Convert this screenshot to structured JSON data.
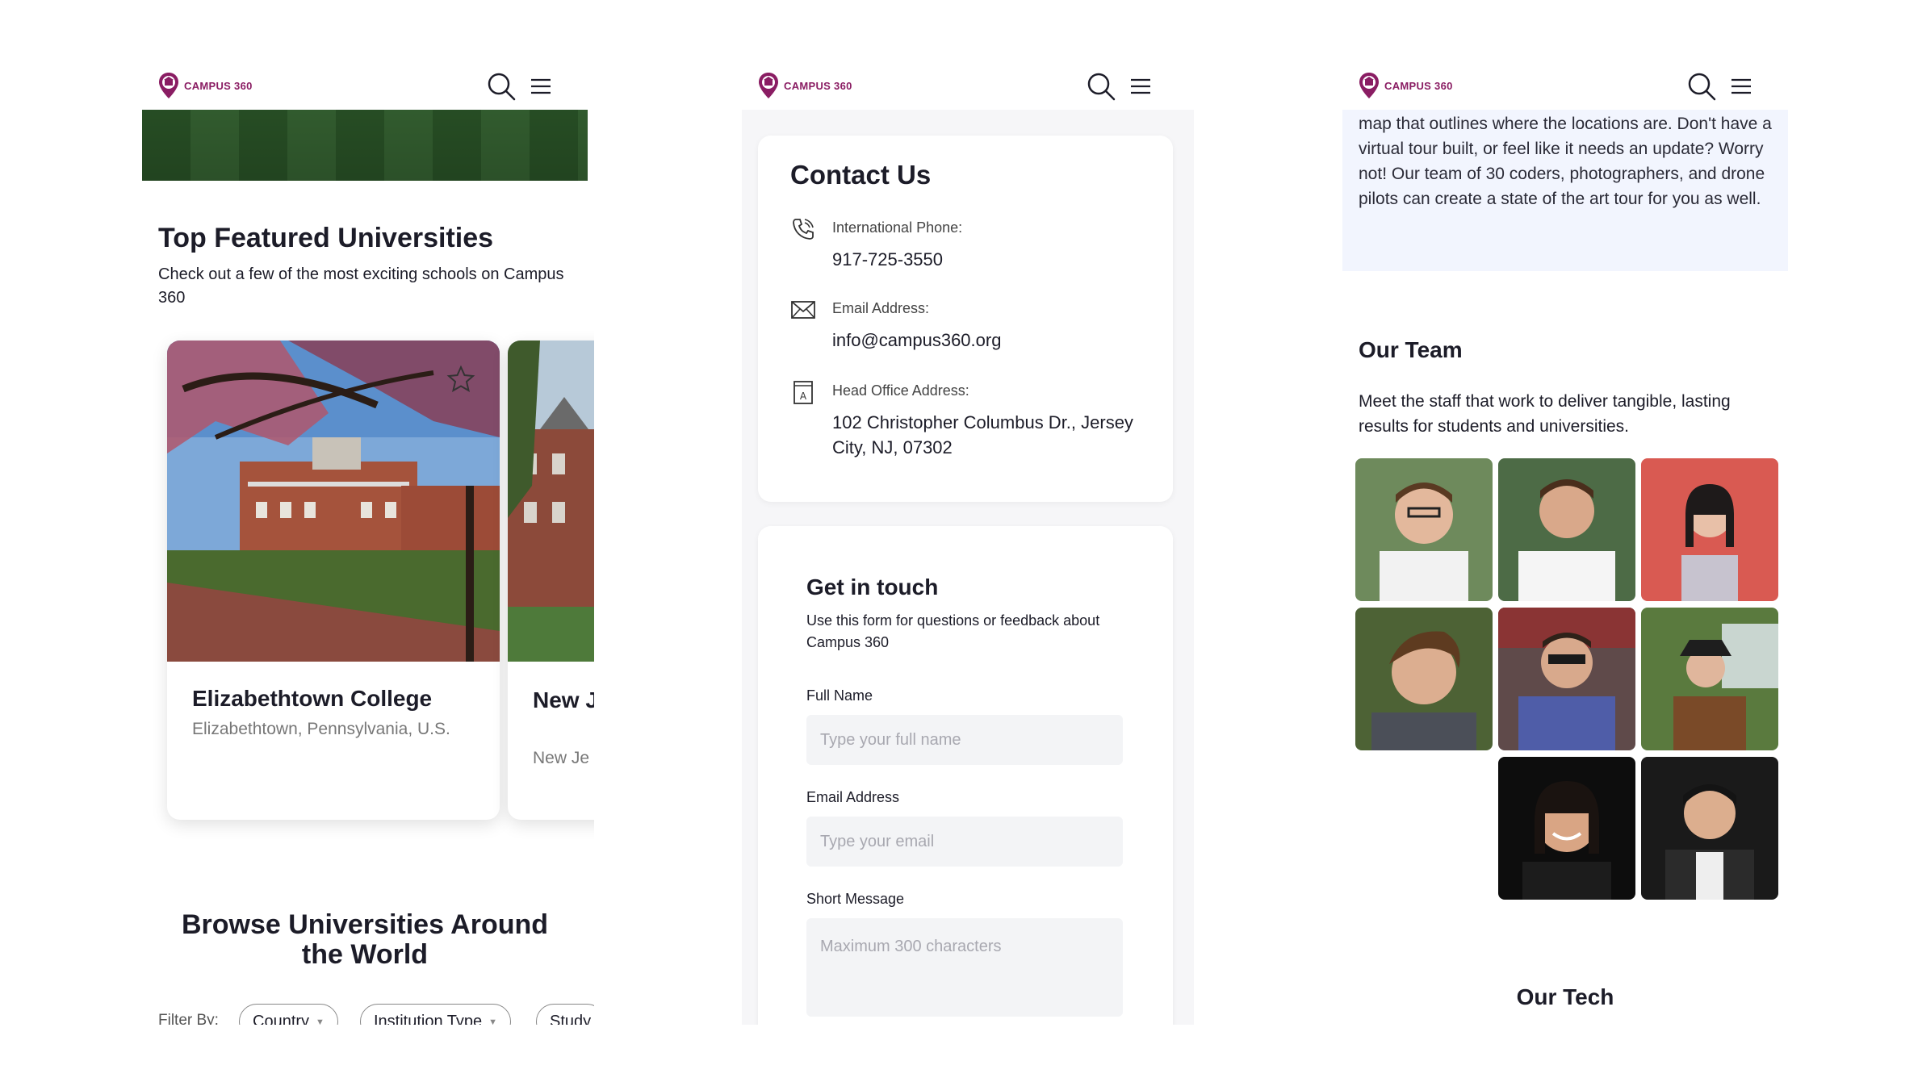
{
  "brand": {
    "name": "CAMPUS 360",
    "color": "#8a1d63"
  },
  "screen1": {
    "title": "Top Featured Universities",
    "subtitle": "Check out a few of the most exciting schools on Campus 360",
    "cards": [
      {
        "name": "Elizabethtown College",
        "location": "Elizabethtown, Pennsylvania, U.S."
      },
      {
        "name": "New J Techr",
        "location": "New Je"
      }
    ],
    "browse_title": "Browse Universities Around the World",
    "filter_label": "Filter By:",
    "filters": [
      "Country",
      "Institution Type",
      "Study"
    ]
  },
  "screen2": {
    "contact_title": "Contact Us",
    "contacts": [
      {
        "icon": "phone-icon",
        "label": "International Phone:",
        "value": "917-725-3550"
      },
      {
        "icon": "mail-icon",
        "label": "Email Address:",
        "value": "info@campus360.org"
      },
      {
        "icon": "office-icon",
        "label": "Head Office Address:",
        "value": "102 Christopher Columbus Dr., Jersey City, NJ, 07302"
      }
    ],
    "form": {
      "title": "Get in touch",
      "subtitle": "Use this form for questions or feedback about Campus 360",
      "full_name_label": "Full Name",
      "full_name_placeholder": "Type your full name",
      "email_label": "Email Address",
      "email_placeholder": "Type your email",
      "message_label": "Short Message",
      "message_placeholder": "Maximum 300 characters"
    }
  },
  "screen3": {
    "about_text": "map that outlines where the locations are. Don't have a virtual tour built, or feel like it needs an update? Worry not! Our team of 30 coders, photographers, and drone pilots can create a state of the art tour for you as well.",
    "team_title": "Our Team",
    "team_subtitle": "Meet the staff that work to deliver tangible, lasting results for students and universities.",
    "tech_title": "Our Tech"
  }
}
